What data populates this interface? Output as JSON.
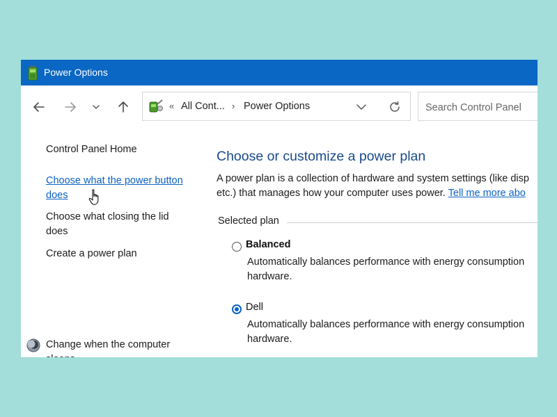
{
  "window": {
    "title": "Power Options"
  },
  "address_bar": {
    "overflow_marker": "«",
    "breadcrumb_1": "All Cont...",
    "breadcrumb_separator": "›",
    "breadcrumb_2": "Power Options"
  },
  "search": {
    "placeholder": "Search Control Panel"
  },
  "sidebar": {
    "home": "Control Panel Home",
    "power_button": [
      "Choose what the power button",
      "does"
    ],
    "closing_lid": [
      "Choose what closing the lid",
      "does"
    ],
    "create_plan": "Create a power plan",
    "sleep": [
      "Change when the computer",
      "sleeps"
    ]
  },
  "main": {
    "title": "Choose or customize a power plan",
    "description_line1": "A power plan is a collection of hardware and system settings (like disp",
    "description_line2": "etc.) that manages how your computer uses power.",
    "tell_me_more": "Tell me more abo",
    "selected_plan_label": "Selected plan",
    "plans": [
      {
        "name": "Balanced",
        "selected": false,
        "description": [
          "Automatically balances performance with energy consumption",
          "hardware."
        ]
      },
      {
        "name": "Dell",
        "selected": true,
        "description": [
          "Automatically balances performance with energy consumption",
          "hardware."
        ]
      }
    ]
  },
  "colors": {
    "titlebar": "#0a67c3",
    "link": "#0b62c4",
    "heading": "#1a4a8a",
    "background": "#a3dedb"
  },
  "icons": {
    "app": "power-options-icon",
    "back": "arrow-left-icon",
    "forward": "arrow-right-icon",
    "recent": "chevron-down-icon",
    "up": "arrow-up-icon",
    "address": "power-options-icon",
    "dropdown": "chevron-down-icon",
    "refresh": "refresh-icon",
    "sleep": "moon-icon",
    "cursor": "hand-pointer-icon"
  }
}
